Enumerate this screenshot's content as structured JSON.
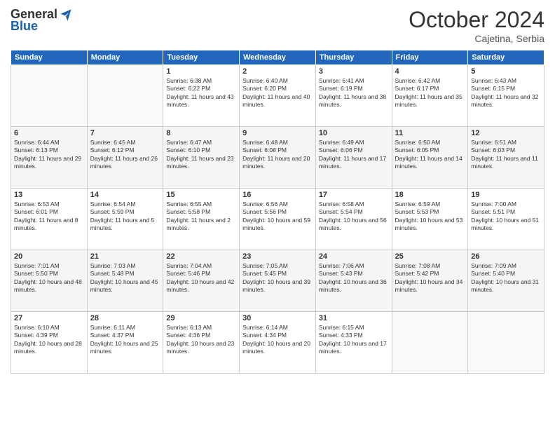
{
  "logo": {
    "general": "General",
    "blue": "Blue"
  },
  "title": "October 2024",
  "location": "Cajetina, Serbia",
  "days_header": [
    "Sunday",
    "Monday",
    "Tuesday",
    "Wednesday",
    "Thursday",
    "Friday",
    "Saturday"
  ],
  "weeks": [
    [
      {
        "day": "",
        "content": ""
      },
      {
        "day": "",
        "content": ""
      },
      {
        "day": "1",
        "content": "Sunrise: 6:38 AM\nSunset: 6:22 PM\nDaylight: 11 hours and 43 minutes."
      },
      {
        "day": "2",
        "content": "Sunrise: 6:40 AM\nSunset: 6:20 PM\nDaylight: 11 hours and 40 minutes."
      },
      {
        "day": "3",
        "content": "Sunrise: 6:41 AM\nSunset: 6:19 PM\nDaylight: 11 hours and 38 minutes."
      },
      {
        "day": "4",
        "content": "Sunrise: 6:42 AM\nSunset: 6:17 PM\nDaylight: 11 hours and 35 minutes."
      },
      {
        "day": "5",
        "content": "Sunrise: 6:43 AM\nSunset: 6:15 PM\nDaylight: 11 hours and 32 minutes."
      }
    ],
    [
      {
        "day": "6",
        "content": "Sunrise: 6:44 AM\nSunset: 6:13 PM\nDaylight: 11 hours and 29 minutes."
      },
      {
        "day": "7",
        "content": "Sunrise: 6:45 AM\nSunset: 6:12 PM\nDaylight: 11 hours and 26 minutes."
      },
      {
        "day": "8",
        "content": "Sunrise: 6:47 AM\nSunset: 6:10 PM\nDaylight: 11 hours and 23 minutes."
      },
      {
        "day": "9",
        "content": "Sunrise: 6:48 AM\nSunset: 6:08 PM\nDaylight: 11 hours and 20 minutes."
      },
      {
        "day": "10",
        "content": "Sunrise: 6:49 AM\nSunset: 6:06 PM\nDaylight: 11 hours and 17 minutes."
      },
      {
        "day": "11",
        "content": "Sunrise: 6:50 AM\nSunset: 6:05 PM\nDaylight: 11 hours and 14 minutes."
      },
      {
        "day": "12",
        "content": "Sunrise: 6:51 AM\nSunset: 6:03 PM\nDaylight: 11 hours and 11 minutes."
      }
    ],
    [
      {
        "day": "13",
        "content": "Sunrise: 6:53 AM\nSunset: 6:01 PM\nDaylight: 11 hours and 8 minutes."
      },
      {
        "day": "14",
        "content": "Sunrise: 6:54 AM\nSunset: 5:59 PM\nDaylight: 11 hours and 5 minutes."
      },
      {
        "day": "15",
        "content": "Sunrise: 6:55 AM\nSunset: 5:58 PM\nDaylight: 11 hours and 2 minutes."
      },
      {
        "day": "16",
        "content": "Sunrise: 6:56 AM\nSunset: 5:56 PM\nDaylight: 10 hours and 59 minutes."
      },
      {
        "day": "17",
        "content": "Sunrise: 6:58 AM\nSunset: 5:54 PM\nDaylight: 10 hours and 56 minutes."
      },
      {
        "day": "18",
        "content": "Sunrise: 6:59 AM\nSunset: 5:53 PM\nDaylight: 10 hours and 53 minutes."
      },
      {
        "day": "19",
        "content": "Sunrise: 7:00 AM\nSunset: 5:51 PM\nDaylight: 10 hours and 51 minutes."
      }
    ],
    [
      {
        "day": "20",
        "content": "Sunrise: 7:01 AM\nSunset: 5:50 PM\nDaylight: 10 hours and 48 minutes."
      },
      {
        "day": "21",
        "content": "Sunrise: 7:03 AM\nSunset: 5:48 PM\nDaylight: 10 hours and 45 minutes."
      },
      {
        "day": "22",
        "content": "Sunrise: 7:04 AM\nSunset: 5:46 PM\nDaylight: 10 hours and 42 minutes."
      },
      {
        "day": "23",
        "content": "Sunrise: 7:05 AM\nSunset: 5:45 PM\nDaylight: 10 hours and 39 minutes."
      },
      {
        "day": "24",
        "content": "Sunrise: 7:06 AM\nSunset: 5:43 PM\nDaylight: 10 hours and 36 minutes."
      },
      {
        "day": "25",
        "content": "Sunrise: 7:08 AM\nSunset: 5:42 PM\nDaylight: 10 hours and 34 minutes."
      },
      {
        "day": "26",
        "content": "Sunrise: 7:09 AM\nSunset: 5:40 PM\nDaylight: 10 hours and 31 minutes."
      }
    ],
    [
      {
        "day": "27",
        "content": "Sunrise: 6:10 AM\nSunset: 4:39 PM\nDaylight: 10 hours and 28 minutes."
      },
      {
        "day": "28",
        "content": "Sunrise: 6:11 AM\nSunset: 4:37 PM\nDaylight: 10 hours and 25 minutes."
      },
      {
        "day": "29",
        "content": "Sunrise: 6:13 AM\nSunset: 4:36 PM\nDaylight: 10 hours and 23 minutes."
      },
      {
        "day": "30",
        "content": "Sunrise: 6:14 AM\nSunset: 4:34 PM\nDaylight: 10 hours and 20 minutes."
      },
      {
        "day": "31",
        "content": "Sunrise: 6:15 AM\nSunset: 4:33 PM\nDaylight: 10 hours and 17 minutes."
      },
      {
        "day": "",
        "content": ""
      },
      {
        "day": "",
        "content": ""
      }
    ]
  ]
}
